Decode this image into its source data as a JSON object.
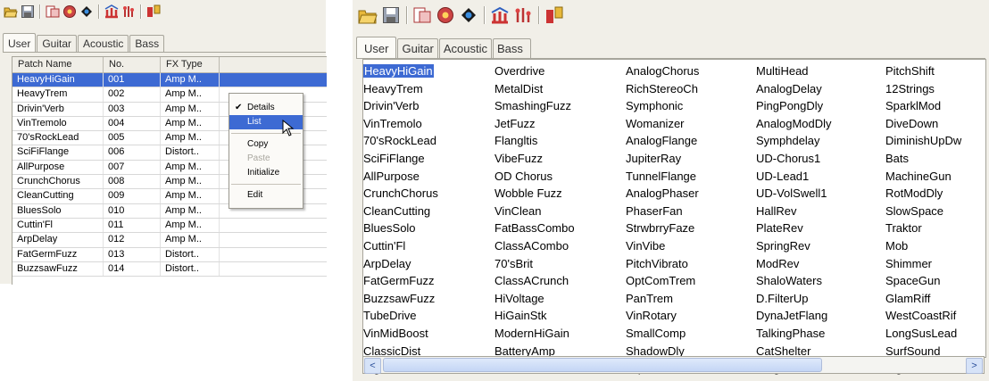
{
  "left_window": {
    "tabs": [
      "User",
      "Guitar",
      "Acoustic",
      "Bass"
    ],
    "active_tab": 0,
    "columns": [
      "Patch Name",
      "No.",
      "FX Type"
    ],
    "rows": [
      {
        "name": "HeavyHiGain",
        "no": "001",
        "fx": "Amp M.."
      },
      {
        "name": "HeavyTrem",
        "no": "002",
        "fx": "Amp M.."
      },
      {
        "name": "Drivin'Verb",
        "no": "003",
        "fx": "Amp M.."
      },
      {
        "name": "VinTremolo",
        "no": "004",
        "fx": "Amp M.."
      },
      {
        "name": "70'sRockLead",
        "no": "005",
        "fx": "Amp M.."
      },
      {
        "name": "SciFiFlange",
        "no": "006",
        "fx": "Distort.."
      },
      {
        "name": "AllPurpose",
        "no": "007",
        "fx": "Amp M.."
      },
      {
        "name": "CrunchChorus",
        "no": "008",
        "fx": "Amp M.."
      },
      {
        "name": "CleanCutting",
        "no": "009",
        "fx": "Amp M.."
      },
      {
        "name": "BluesSolo",
        "no": "010",
        "fx": "Amp M.."
      },
      {
        "name": "Cuttin'Fl",
        "no": "011",
        "fx": "Amp M.."
      },
      {
        "name": "ArpDelay",
        "no": "012",
        "fx": "Amp M.."
      },
      {
        "name": "FatGermFuzz",
        "no": "013",
        "fx": "Distort.."
      },
      {
        "name": "BuzzsawFuzz",
        "no": "014",
        "fx": "Distort.."
      }
    ],
    "context_menu": {
      "items": [
        "Details",
        "List",
        "Copy",
        "Paste",
        "Initialize",
        "Edit"
      ]
    }
  },
  "right_window": {
    "tabs": [
      "User",
      "Guitar",
      "Acoustic",
      "Bass"
    ],
    "active_tab": 0,
    "columns": [
      [
        "HeavyHiGain",
        "HeavyTrem",
        "Drivin'Verb",
        "VinTremolo",
        "70'sRockLead",
        "SciFiFlange",
        "AllPurpose",
        "CrunchChorus",
        "CleanCutting",
        "BluesSolo",
        "Cuttin'Fl",
        "ArpDelay",
        "FatGermFuzz",
        "BuzzsawFuzz",
        "TubeDrive",
        "VinMidBoost",
        "ClassicDist",
        "BigSusFuzz"
      ],
      [
        "Overdrive",
        "MetalDist",
        "SmashingFuzz",
        "JetFuzz",
        "Flangltis",
        "VibeFuzz",
        "OD Chorus",
        "Wobble Fuzz",
        "VinClean",
        "FatBassCombo",
        "ClassACombo",
        "70'sBrit",
        "ClassACrunch",
        "HiVoltage",
        "HiGainStk",
        "ModernHiGain",
        "BatteryAmp",
        "Small Radio"
      ],
      [
        "AnalogChorus",
        "RichStereoCh",
        "Symphonic",
        "Womanizer",
        "AnalogFlange",
        "JupiterRay",
        "TunnelFlange",
        "AnalogPhaser",
        "PhaserFan",
        "StrwbrryFaze",
        "VinVibe",
        "PitchVibrato",
        "OptComTrem",
        "PanTrem",
        "VinRotary",
        "SmallComp",
        "ShadowDly",
        "TapeEcho"
      ],
      [
        "MultiHead",
        "AnalogDelay",
        "PingPongDly",
        "AnalogModDly",
        "Symphdelay",
        "UD-Chorus1",
        "UD-Lead1",
        "UD-VolSwell1",
        "HallRev",
        "PlateRev",
        "SpringRev",
        "ModRev",
        "ShaloWaters",
        "D.FilterUp",
        "DynaJetFlang",
        "TalkingPhase",
        "CatShelter",
        "RingMod"
      ],
      [
        "PitchShift",
        "12Strings",
        "SparklMod",
        "DiveDown",
        "DiminishUpDw",
        "Bats",
        "MachineGun",
        "RotModDly",
        "SlowSpace",
        "Traktor",
        "Mob",
        "Shimmer",
        "SpaceGun",
        "GlamRiff",
        "WestCoastRif",
        "LongSusLead",
        "SurfSound",
        "BigRock"
      ]
    ],
    "scrollbar": {
      "left_arrow": "<",
      "right_arrow": ">"
    }
  },
  "icons": [
    "folder-open-icon",
    "save-icon",
    "patch-write-icon",
    "tuner-icon",
    "rhythm-icon",
    "bank-icon",
    "pedal-icon",
    "help-icon"
  ],
  "colors": {
    "selection": "#3d6ad3",
    "window_bg": "#f1efe8"
  }
}
